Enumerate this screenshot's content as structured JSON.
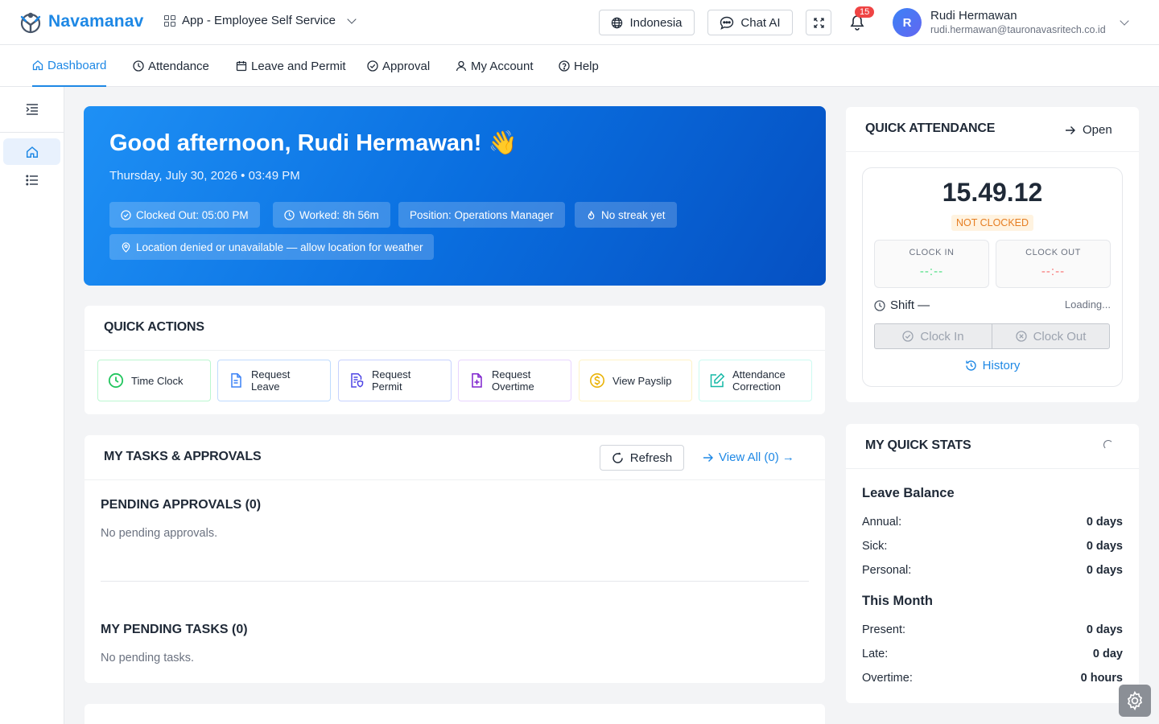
{
  "brand": {
    "name": "Navamanav"
  },
  "header": {
    "app_switch_label": "App - Employee Self Service",
    "language_label": "Indonesia",
    "chat_label": "Chat AI",
    "notification_count": "15",
    "user": {
      "initial": "R",
      "name": "Rudi Hermawan",
      "email": "rudi.hermawan@tauronavasritech.co.id"
    }
  },
  "nav": {
    "items": [
      {
        "label": "Dashboard",
        "icon": "home-icon",
        "active": true
      },
      {
        "label": "Attendance",
        "icon": "clock-icon"
      },
      {
        "label": "Leave and Permit",
        "icon": "calendar-icon"
      },
      {
        "label": "Approval",
        "icon": "check-circle-icon"
      },
      {
        "label": "My Account",
        "icon": "user-icon"
      },
      {
        "label": "Help",
        "icon": "help-icon"
      }
    ]
  },
  "hero": {
    "greeting": "Good afternoon, Rudi Hermawan! 👋",
    "datetime": "Thursday, July 30, 2026 • 03:49 PM",
    "chips": [
      "Clocked Out: 05:00 PM",
      "Worked: 8h 56m",
      "Position: Operations Manager",
      "No streak yet",
      "Location denied or unavailable — allow location for weather"
    ]
  },
  "quick_actions": {
    "title": "QUICK ACTIONS",
    "items": [
      {
        "label": "Time Clock",
        "color": "#22c55e"
      },
      {
        "label": "Request Leave",
        "color": "#3b82f6"
      },
      {
        "label": "Request Permit",
        "color": "#4f46e5"
      },
      {
        "label": "Request Overtime",
        "color": "#7e22ce"
      },
      {
        "label": "View Payslip",
        "color": "#eab308"
      },
      {
        "label": "Attendance Correction",
        "color": "#14b8a6"
      }
    ]
  },
  "tasks": {
    "title": "MY TASKS & APPROVALS",
    "refresh_label": "Refresh",
    "view_all_label": "View All (0) →",
    "pending_approvals_title": "PENDING APPROVALS (0)",
    "pending_approvals_empty": "No pending approvals.",
    "pending_tasks_title": "MY PENDING TASKS (0)",
    "pending_tasks_empty": "No pending tasks."
  },
  "quick_attendance": {
    "title": "QUICK ATTENDANCE",
    "open_label": "Open",
    "time": "15.49.12",
    "status": "NOT CLOCKED",
    "clock_in_label": "CLOCK IN",
    "clock_in_value": "--:--",
    "clock_out_label": "CLOCK OUT",
    "clock_out_value": "--:--",
    "shift_label": "Shift —",
    "loading_label": "Loading...",
    "clock_in_button": "Clock In",
    "clock_out_button": "Clock Out",
    "history_label": "History"
  },
  "quick_stats": {
    "title": "MY QUICK STATS",
    "leave_balance_title": "Leave Balance",
    "leave": [
      {
        "label": "Annual:",
        "value": "0 days"
      },
      {
        "label": "Sick:",
        "value": "0 days"
      },
      {
        "label": "Personal:",
        "value": "0 days"
      }
    ],
    "this_month_title": "This Month",
    "month": [
      {
        "label": "Present:",
        "value": "0 days"
      },
      {
        "label": "Late:",
        "value": "0 day"
      },
      {
        "label": "Overtime:",
        "value": "0 hours"
      }
    ]
  },
  "colors": {
    "accent": "#1e88e5",
    "badge": "#ef4444",
    "clock_in": "#4ade80",
    "clock_out": "#f87171"
  }
}
